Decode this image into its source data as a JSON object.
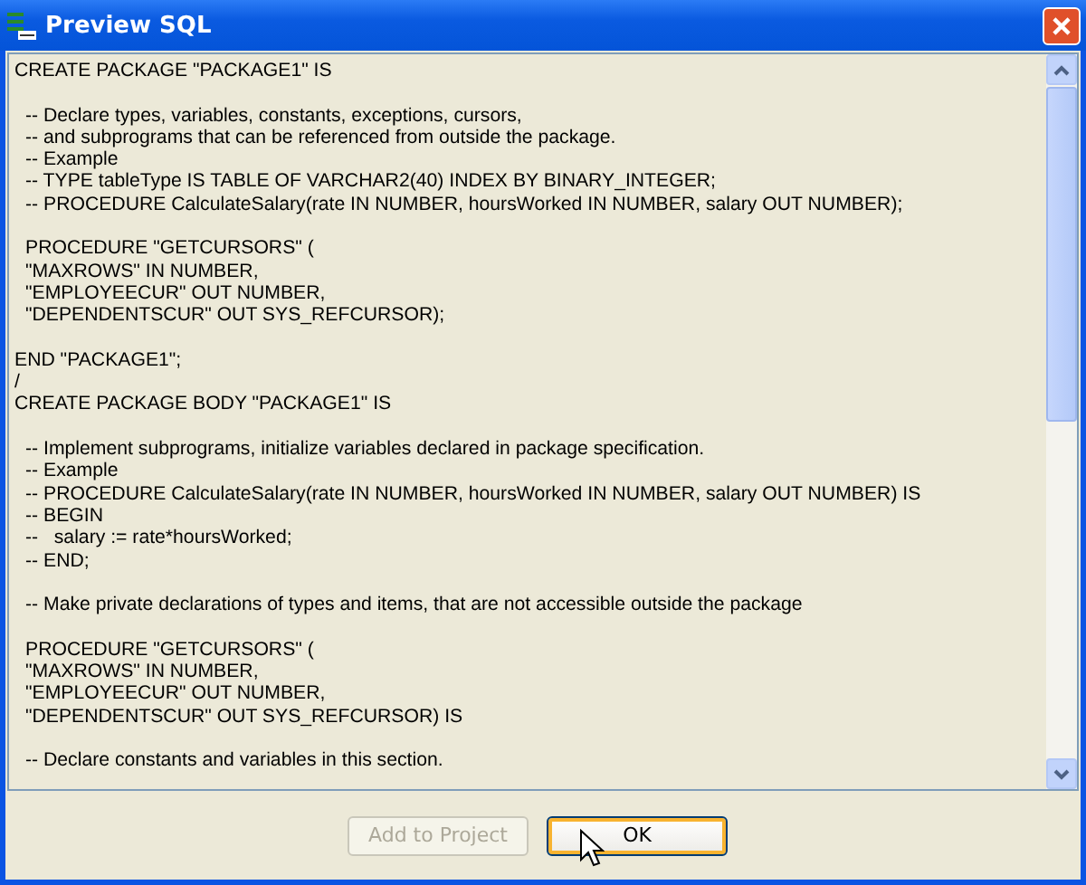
{
  "window": {
    "title": "Preview SQL"
  },
  "sql_preview": {
    "blocks": [
      {
        "indented": false,
        "lines": [
          "CREATE PACKAGE \"PACKAGE1\" IS"
        ]
      },
      {
        "indented": true,
        "lines": [
          "-- Declare types, variables, constants, exceptions, cursors,",
          "-- and subprograms that can be referenced from outside the package.",
          "-- Example",
          "-- TYPE tableType IS TABLE OF VARCHAR2(40) INDEX BY BINARY_INTEGER;",
          "-- PROCEDURE CalculateSalary(rate IN NUMBER, hoursWorked IN NUMBER, salary OUT NUMBER);"
        ]
      },
      {
        "indented": true,
        "lines": [
          "PROCEDURE \"GETCURSORS\" (",
          "\"MAXROWS\" IN NUMBER,",
          "\"EMPLOYEECUR\" OUT NUMBER,",
          "\"DEPENDENTSCUR\" OUT SYS_REFCURSOR);"
        ]
      },
      {
        "indented": false,
        "lines": [
          "END \"PACKAGE1\";",
          "/",
          "CREATE PACKAGE BODY \"PACKAGE1\" IS"
        ]
      },
      {
        "indented": true,
        "lines": [
          "-- Implement subprograms, initialize variables declared in package specification.",
          "-- Example",
          "-- PROCEDURE CalculateSalary(rate IN NUMBER, hoursWorked IN NUMBER, salary OUT NUMBER) IS",
          "-- BEGIN",
          "--   salary := rate*hoursWorked;",
          "-- END;"
        ]
      },
      {
        "indented": true,
        "lines": [
          "-- Make private declarations of types and items, that are not accessible outside the package"
        ]
      },
      {
        "indented": true,
        "lines": [
          "PROCEDURE \"GETCURSORS\" (",
          "\"MAXROWS\" IN NUMBER,",
          "\"EMPLOYEECUR\" OUT NUMBER,",
          "\"DEPENDENTSCUR\" OUT SYS_REFCURSOR) IS"
        ]
      },
      {
        "indented": true,
        "lines": [
          "-- Declare constants and variables in this section."
        ]
      }
    ]
  },
  "buttons": [
    {
      "label": "Add to Project",
      "disabled": true,
      "focused": false
    },
    {
      "label": "OK",
      "disabled": false,
      "focused": true
    }
  ]
}
